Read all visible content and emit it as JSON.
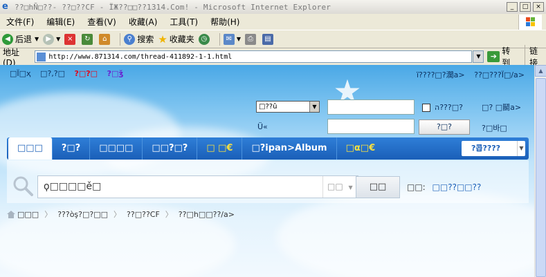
{
  "window": {
    "title": "??□hÑ□??- ??□??CF - ÏЖ??□□??1314.Com! - Microsoft Internet Explorer"
  },
  "menu": [
    "文件(F)",
    "编辑(E)",
    "查看(V)",
    "收藏(A)",
    "工具(T)",
    "帮助(H)"
  ],
  "toolbar": {
    "back": "后退",
    "search": "搜索",
    "favorites": "收藏夹"
  },
  "address": {
    "label": "地址(D)",
    "url": "http://www.871314.com/thread-411892-1-1.html",
    "go": "转到",
    "links": "链接"
  },
  "page": {
    "topleft": [
      "□Ï□ҳ",
      "□?,?□",
      "?□?□",
      "?□ǯ"
    ],
    "topright": [
      "ï????□?濶a>",
      "??□???Ï□/a>"
    ],
    "login": {
      "select_value": "□??û",
      "field_label_2": "Ü«",
      "remember_label": "ה???□?",
      "register_link": "□?  □鬭a>",
      "forgot_link": "?□바□",
      "login_button": "?□?"
    },
    "nav": [
      "□□□",
      "?□?",
      "□□□□",
      "□□?□?",
      "□ □€",
      "□?ipan>Album",
      "□α□€"
    ],
    "nav_select": "?콥????",
    "search": {
      "value": "ϙ□□□□ě□",
      "type": "□□",
      "button": "□□",
      "hot_label": "□□:",
      "hot_words": "□□??□□??"
    },
    "breadcrumb": [
      "□□□",
      "???òş?□?□□",
      "??□??CF",
      "??□h□□??/a>"
    ]
  }
}
